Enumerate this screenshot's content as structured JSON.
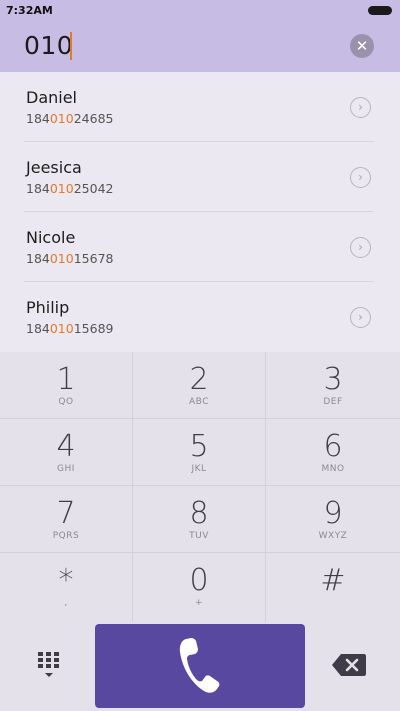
{
  "status_bar": {
    "time": "7:32AM"
  },
  "dialer": {
    "input_value": "010",
    "clear_icon": "close-icon"
  },
  "contacts": [
    {
      "name": "Daniel",
      "number_pre": "184",
      "number_match": "010",
      "number_post": "24685"
    },
    {
      "name": "Jeesica",
      "number_pre": "184",
      "number_match": "010",
      "number_post": "25042"
    },
    {
      "name": "Nicole",
      "number_pre": "184",
      "number_match": "010",
      "number_post": "15678"
    },
    {
      "name": "Philip",
      "number_pre": "184",
      "number_match": "010",
      "number_post": "15689"
    }
  ],
  "keypad": {
    "keys": [
      {
        "digit": "1",
        "letters": "QO"
      },
      {
        "digit": "2",
        "letters": "ABC"
      },
      {
        "digit": "3",
        "letters": "DEF"
      },
      {
        "digit": "4",
        "letters": "GHI"
      },
      {
        "digit": "5",
        "letters": "JKL"
      },
      {
        "digit": "6",
        "letters": "MNO"
      },
      {
        "digit": "7",
        "letters": "PQRS"
      },
      {
        "digit": "8",
        "letters": "TUV"
      },
      {
        "digit": "9",
        "letters": "WXYZ"
      },
      {
        "digit": "*",
        "letters": ","
      },
      {
        "digit": "0",
        "letters": "+"
      },
      {
        "digit": "#",
        "letters": ""
      }
    ]
  },
  "bottom_bar": {
    "keypad_toggle_icon": "dialpad-icon",
    "call_icon": "phone-icon",
    "backspace_icon": "backspace-icon"
  },
  "colors": {
    "accent": "#5848a0",
    "header": "#c7bce4",
    "highlight": "#e07a2c"
  }
}
